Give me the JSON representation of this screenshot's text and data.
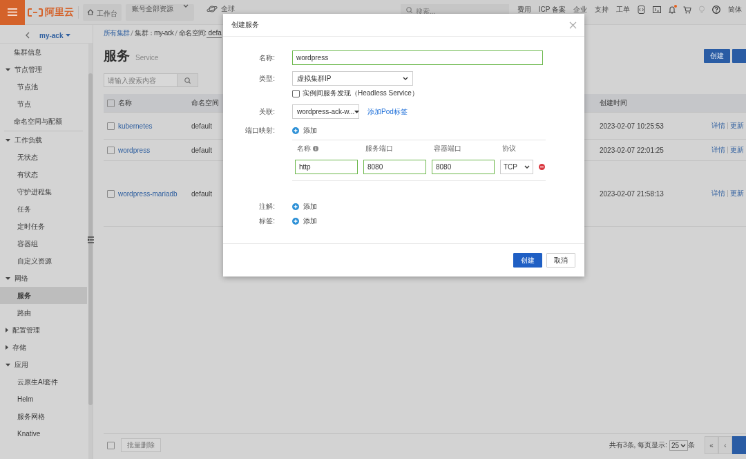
{
  "topbar": {
    "logo_text": "阿里云",
    "workbench": "工作台",
    "resources": "账号全部资源",
    "region": "全球",
    "search_placeholder": "搜索...",
    "links": [
      "费用",
      "ICP 备案",
      "企业",
      "支持",
      "工单"
    ],
    "unread": true,
    "language": "简体"
  },
  "sidebar": {
    "cluster": "my-ack",
    "items": [
      {
        "label": "集群信息",
        "selected": false
      },
      {
        "label": "节点管理",
        "selected": false,
        "expanded": true,
        "children": [
          {
            "label": "节点池",
            "selected": false
          },
          {
            "label": "节点",
            "selected": false
          }
        ]
      },
      {
        "label": "命名空间与配额",
        "selected": false
      },
      {
        "label": "工作负载",
        "selected": false,
        "separated": true,
        "expanded": true,
        "children": [
          {
            "label": "无状态",
            "selected": false
          },
          {
            "label": "有状态",
            "selected": false
          },
          {
            "label": "守护进程集",
            "selected": false
          },
          {
            "label": "任务",
            "selected": false
          },
          {
            "label": "定时任务",
            "selected": false
          },
          {
            "label": "容器组",
            "selected": false
          },
          {
            "label": "自定义资源",
            "selected": false
          }
        ]
      },
      {
        "label": "网络",
        "selected": false,
        "expanded": true,
        "children": [
          {
            "label": "服务",
            "selected": true
          },
          {
            "label": "路由",
            "selected": false
          }
        ]
      },
      {
        "label": "配置管理",
        "selected": false,
        "expanded": false
      },
      {
        "label": "存储",
        "selected": false,
        "expanded": false
      },
      {
        "label": "应用",
        "selected": false,
        "expanded": true,
        "children": [
          {
            "label": "云原生AI套件",
            "selected": false
          },
          {
            "label": "Helm",
            "selected": false
          },
          {
            "label": "服务网格",
            "selected": false
          },
          {
            "label": "Knative",
            "selected": false
          }
        ]
      }
    ]
  },
  "breadcrumb": {
    "root": "所有集群",
    "cluster": "集群：my-ack",
    "namespace_label": "命名空间:",
    "namespace_value": "defa"
  },
  "page": {
    "title": "服务",
    "subtitle": "Service",
    "search_placeholder": "请输入搜索内容",
    "create_button": "创建"
  },
  "table": {
    "checked": false,
    "columns": [
      "名称",
      "命名空间",
      "创建时间"
    ],
    "rows": [
      {
        "checked": false,
        "name": "kubernetes",
        "namespace": "default",
        "created": "2023-02-07 10:25:53",
        "actions": [
          "详情",
          "更新"
        ]
      },
      {
        "checked": false,
        "name": "wordpress",
        "namespace": "default",
        "created": "2023-02-07 22:01:25",
        "actions": [
          "详情",
          "更新"
        ]
      },
      {
        "checked": false,
        "name": "wordpress-mariadb",
        "namespace": "default",
        "created": "2023-02-07 21:58:13",
        "actions": [
          "详情",
          "更新"
        ]
      }
    ]
  },
  "footer": {
    "checked": false,
    "batch_delete": "批量删除",
    "batch_disabled": true,
    "total": "共有3条, 每页显示:",
    "page_size": "25",
    "unit": "条",
    "first": "«",
    "prev": "‹"
  },
  "dialog": {
    "title": "创建服务",
    "fields": [
      {
        "kind": "text",
        "label": "名称:",
        "value": "wordpress"
      },
      {
        "kind": "select",
        "label": "类型:",
        "value": "虚拟集群IP",
        "option": {
          "label": "实例间服务发现（Headless Service）",
          "checked": false
        }
      },
      {
        "kind": "select-link",
        "label": "关联:",
        "value": "wordpress-ack-w...",
        "link": "添加Pod标签"
      },
      {
        "kind": "ports",
        "label": "端口映射:",
        "add": "添加",
        "columns": [
          "名称",
          "服务端口",
          "容器端口",
          "协议"
        ],
        "rows": [
          {
            "name": "http",
            "service_port": "8080",
            "container_port": "8080",
            "protocol": "TCP"
          }
        ]
      },
      {
        "kind": "add",
        "label": "注解:",
        "add": "添加"
      },
      {
        "kind": "add",
        "label": "标签:",
        "add": "添加"
      }
    ],
    "buttons": [
      {
        "label": "创建",
        "primary": true
      },
      {
        "label": "取消",
        "primary": false
      }
    ]
  }
}
